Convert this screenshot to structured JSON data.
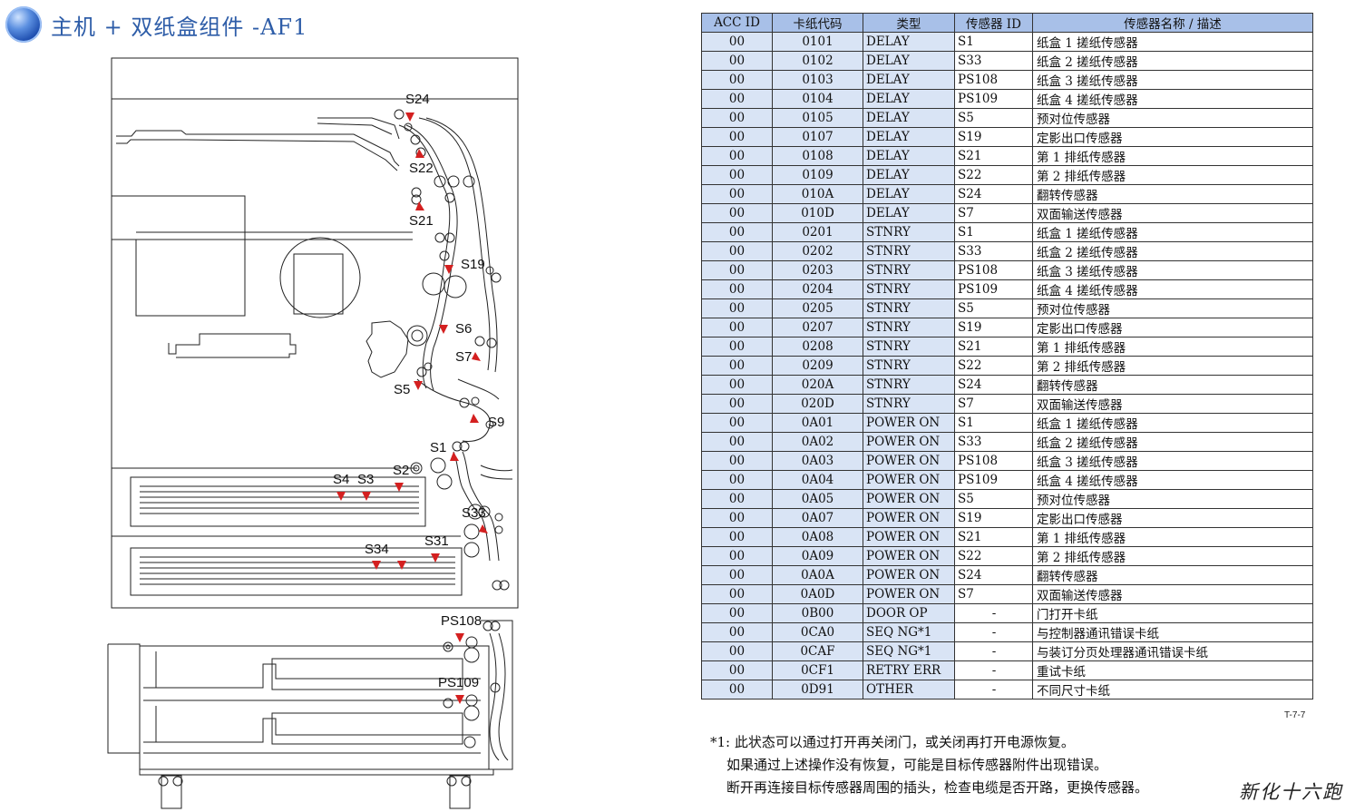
{
  "title": "主机 + 双纸盒组件 -AF1",
  "diagram": {
    "labels": [
      "S24",
      "S22",
      "S21",
      "S19",
      "S6",
      "S7",
      "S5",
      "S9",
      "S1",
      "S2",
      "S4",
      "S3",
      "S33",
      "S34",
      "S31",
      "PS108",
      "PS109"
    ]
  },
  "table": {
    "headers": [
      "ACC ID",
      "卡纸代码",
      "类型",
      "传感器 ID",
      "传感器名称 / 描述"
    ],
    "rows": [
      [
        "00",
        "0101",
        "DELAY",
        "S1",
        "纸盒 1 搓纸传感器"
      ],
      [
        "00",
        "0102",
        "DELAY",
        "S33",
        "纸盒 2 搓纸传感器"
      ],
      [
        "00",
        "0103",
        "DELAY",
        "PS108",
        "纸盒 3 搓纸传感器"
      ],
      [
        "00",
        "0104",
        "DELAY",
        "PS109",
        "纸盒 4 搓纸传感器"
      ],
      [
        "00",
        "0105",
        "DELAY",
        "S5",
        "预对位传感器"
      ],
      [
        "00",
        "0107",
        "DELAY",
        "S19",
        "定影出口传感器"
      ],
      [
        "00",
        "0108",
        "DELAY",
        "S21",
        "第 1 排纸传感器"
      ],
      [
        "00",
        "0109",
        "DELAY",
        "S22",
        "第 2 排纸传感器"
      ],
      [
        "00",
        "010A",
        "DELAY",
        "S24",
        "翻转传感器"
      ],
      [
        "00",
        "010D",
        "DELAY",
        "S7",
        "双面输送传感器"
      ],
      [
        "00",
        "0201",
        "STNRY",
        "S1",
        "纸盒 1 搓纸传感器"
      ],
      [
        "00",
        "0202",
        "STNRY",
        "S33",
        "纸盒 2 搓纸传感器"
      ],
      [
        "00",
        "0203",
        "STNRY",
        "PS108",
        "纸盒 3 搓纸传感器"
      ],
      [
        "00",
        "0204",
        "STNRY",
        "PS109",
        "纸盒 4 搓纸传感器"
      ],
      [
        "00",
        "0205",
        "STNRY",
        "S5",
        "预对位传感器"
      ],
      [
        "00",
        "0207",
        "STNRY",
        "S19",
        "定影出口传感器"
      ],
      [
        "00",
        "0208",
        "STNRY",
        "S21",
        "第 1 排纸传感器"
      ],
      [
        "00",
        "0209",
        "STNRY",
        "S22",
        "第 2 排纸传感器"
      ],
      [
        "00",
        "020A",
        "STNRY",
        "S24",
        "翻转传感器"
      ],
      [
        "00",
        "020D",
        "STNRY",
        "S7",
        "双面输送传感器"
      ],
      [
        "00",
        "0A01",
        "POWER ON",
        "S1",
        "纸盒 1 搓纸传感器"
      ],
      [
        "00",
        "0A02",
        "POWER ON",
        "S33",
        "纸盒 2 搓纸传感器"
      ],
      [
        "00",
        "0A03",
        "POWER ON",
        "PS108",
        "纸盒 3 搓纸传感器"
      ],
      [
        "00",
        "0A04",
        "POWER ON",
        "PS109",
        "纸盒 4 搓纸传感器"
      ],
      [
        "00",
        "0A05",
        "POWER ON",
        "S5",
        "预对位传感器"
      ],
      [
        "00",
        "0A07",
        "POWER ON",
        "S19",
        "定影出口传感器"
      ],
      [
        "00",
        "0A08",
        "POWER ON",
        "S21",
        "第 1 排纸传感器"
      ],
      [
        "00",
        "0A09",
        "POWER ON",
        "S22",
        "第 2 排纸传感器"
      ],
      [
        "00",
        "0A0A",
        "POWER ON",
        "S24",
        "翻转传感器"
      ],
      [
        "00",
        "0A0D",
        "POWER ON",
        "S7",
        "双面输送传感器"
      ],
      [
        "00",
        "0B00",
        "DOOR OP",
        "-",
        "门打开卡纸"
      ],
      [
        "00",
        "0CA0",
        "SEQ NG*1",
        "-",
        "与控制器通讯错误卡纸"
      ],
      [
        "00",
        "0CAF",
        "SEQ NG*1",
        "-",
        "与装订分页处理器通讯错误卡纸"
      ],
      [
        "00",
        "0CF1",
        "RETRY ERR",
        "-",
        "重试卡纸"
      ],
      [
        "00",
        "0D91",
        "OTHER",
        "-",
        "不同尺寸卡纸"
      ]
    ]
  },
  "ref": "T-7-7",
  "notes": [
    "*1: 此状态可以通过打开再关闭门，或关闭再打开电源恢复。",
    "如果通过上述操作没有恢复，可能是目标传感器附件出现错误。",
    "断开再连接目标传感器周围的插头，检查电缆是否开路，更换传感器。"
  ],
  "watermark": "新化十六跑",
  "colors": {
    "title": "#2e5da8",
    "header_bg": "#a8c0e8",
    "cell_shade": "#d9e4f5",
    "sensor_marker": "#d42020"
  }
}
